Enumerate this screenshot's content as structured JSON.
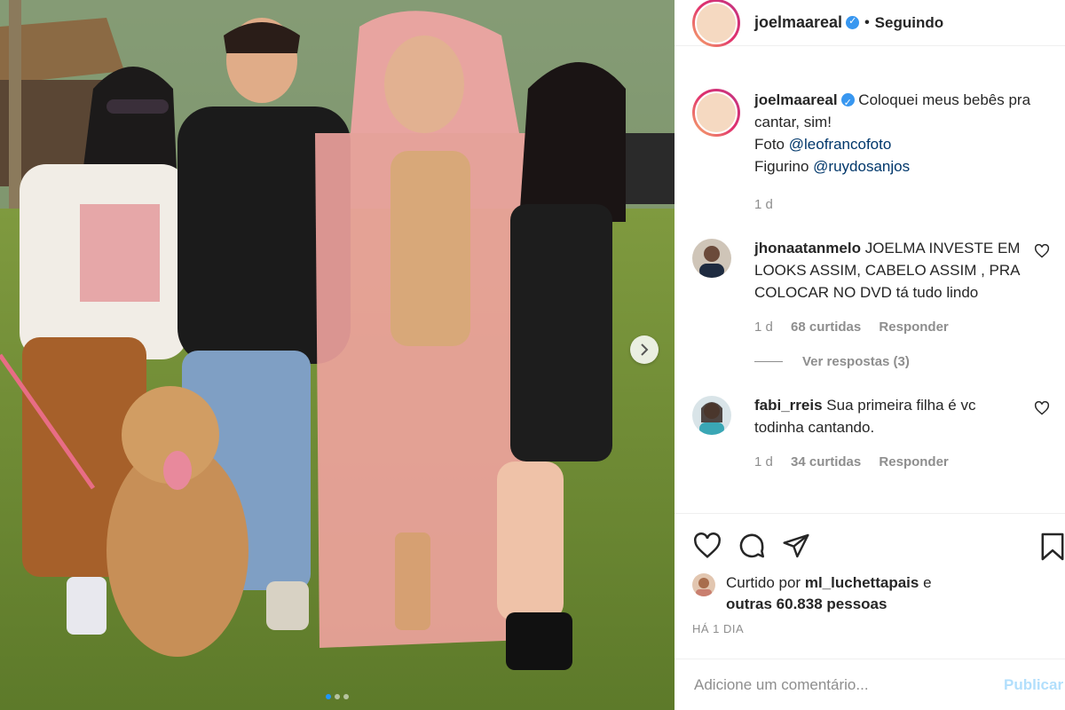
{
  "post": {
    "author": "joelmaareal",
    "follow_separator": "•",
    "follow_status": "Seguindo",
    "caption": {
      "username": "joelmaareal",
      "text_line1": "Coloquei meus bebês pra cantar, sim!",
      "photo_prefix": "Foto",
      "photo_credit": "@leofrancofoto",
      "costume_prefix": "Figurino",
      "costume_credit": "@ruydosanjos",
      "time": "1 d"
    },
    "comments": [
      {
        "username": "jhonaatanmelo",
        "text": "JOELMA INVESTE EM LOOKS ASSIM, CABELO ASSIM , PRA COLOCAR NO DVD tá tudo lindo",
        "time": "1 d",
        "likes": "68 curtidas",
        "reply": "Responder",
        "view_replies": "Ver respostas (3)"
      },
      {
        "username": "fabi_rreis",
        "text": "Sua primeira filha é vc todinha cantando.",
        "time": "1 d",
        "likes": "34 curtidas",
        "reply": "Responder"
      }
    ],
    "liked_by_prefix": "Curtido por",
    "liked_by_user": "ml_luchettapais",
    "liked_by_suffix": "e",
    "liked_by_others": "outras 60.838 pessoas",
    "posted_ago": "HÁ 1 DIA",
    "comment_placeholder": "Adicione um comentário...",
    "publish_label": "Publicar"
  },
  "carousel": {
    "slides": 3,
    "active": 1
  },
  "colors": {
    "accent_blue": "#3897f0",
    "link": "#00376b",
    "muted": "#8e8e8e",
    "publish_disabled": "#b2dffc"
  },
  "icons": [
    "heart-icon",
    "comment-icon",
    "share-icon",
    "bookmark-icon",
    "verified-icon",
    "chevron-right-icon"
  ]
}
